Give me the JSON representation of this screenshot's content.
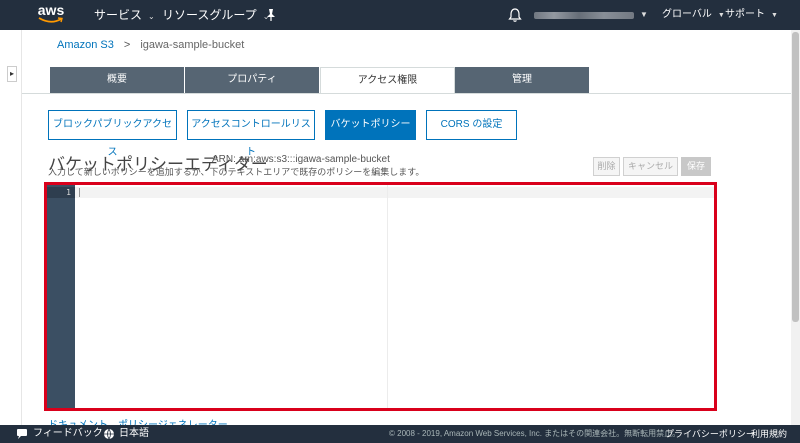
{
  "brand": {
    "logo_text": "aws"
  },
  "nav": {
    "services": "サービス",
    "resource_groups": "リソースグループ",
    "region": "グローバル",
    "support": "サポート"
  },
  "breadcrumb": {
    "root": "Amazon S3",
    "separator": ">",
    "bucket": "igawa-sample-bucket"
  },
  "tabs": [
    "概要",
    "プロパティ",
    "アクセス権限",
    "管理"
  ],
  "subtabs": [
    "ブロックパブリックアクセス",
    "アクセスコントロールリスト",
    "バケットポリシー",
    "CORS の設定"
  ],
  "editor": {
    "title": "バケットポリシーエディター",
    "arn": "ARN: arn:aws:s3:::igawa-sample-bucket",
    "description": "入力して新しいポリシーを追加するか、下のテキストエリアで既存のポリシーを編集します。",
    "delete": "削除",
    "cancel": "キャンセル",
    "save": "保存",
    "line_number": "1"
  },
  "links": {
    "docs": "ドキュメント",
    "generator": "ポリシージェネレーター"
  },
  "footer": {
    "feedback": "フィードバック",
    "language": "日本語",
    "copyright": "© 2008 - 2019, Amazon Web Services, Inc. またはその関連会社。無断転用禁止。",
    "privacy": "プライバシーポリシー",
    "terms": "利用規約"
  },
  "colors": {
    "nav_bg": "#232f3e",
    "accent": "#0073bb",
    "highlight": "#d9001b",
    "tab_bg": "#566573",
    "gutter": "#3b4f63"
  }
}
